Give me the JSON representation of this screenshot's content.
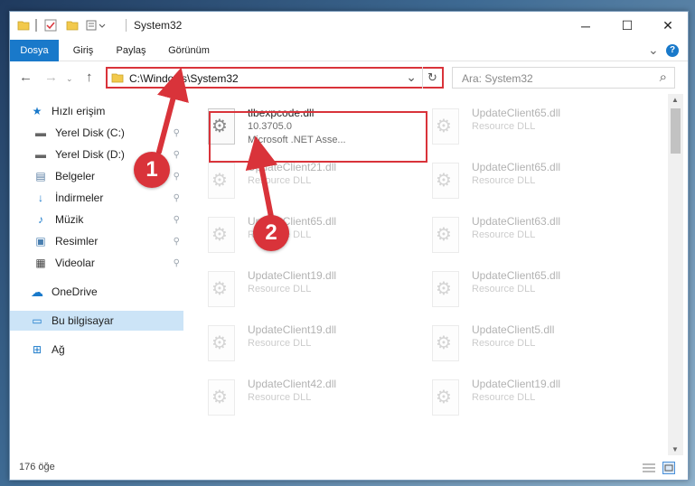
{
  "window": {
    "title": "System32",
    "min_glyph": "─",
    "max_glyph": "☐",
    "close_glyph": "✕"
  },
  "ribbon": {
    "tabs": [
      "Dosya",
      "Giriş",
      "Paylaş",
      "Görünüm"
    ],
    "expand_glyph": "⌄",
    "help_glyph": "?"
  },
  "nav": {
    "back_glyph": "←",
    "forward_glyph": "→",
    "up_glyph": "↑",
    "path": "C:\\Windows\\System32",
    "dropdown_glyph": "⌄",
    "refresh_glyph": "↻",
    "search_placeholder": "Ara: System32",
    "search_glyph": "⌕"
  },
  "sidebar": {
    "items": [
      {
        "label": "Hızlı erişim",
        "icon": "star-icon",
        "glyph": "★",
        "pinned": false
      },
      {
        "label": "Yerel Disk (C:)",
        "icon": "drive-icon",
        "glyph": "▬",
        "pinned": true
      },
      {
        "label": "Yerel Disk (D:)",
        "icon": "drive-icon",
        "glyph": "▬",
        "pinned": true
      },
      {
        "label": "Belgeler",
        "icon": "documents-icon",
        "glyph": "▤",
        "pinned": true
      },
      {
        "label": "İndirmeler",
        "icon": "download-icon",
        "glyph": "↓",
        "pinned": true
      },
      {
        "label": "Müzik",
        "icon": "music-icon",
        "glyph": "♪",
        "pinned": true
      },
      {
        "label": "Resimler",
        "icon": "pictures-icon",
        "glyph": "▣",
        "pinned": true
      },
      {
        "label": "Videolar",
        "icon": "video-icon",
        "glyph": "▦",
        "pinned": true
      },
      {
        "label": "OneDrive",
        "icon": "cloud-icon",
        "glyph": "☁",
        "pinned": false
      },
      {
        "label": "Bu bilgisayar",
        "icon": "computer-icon",
        "glyph": "▭",
        "pinned": false
      },
      {
        "label": "Ağ",
        "icon": "network-icon",
        "glyph": "⊞",
        "pinned": false
      }
    ],
    "pin_glyph": "⚲"
  },
  "files": [
    {
      "name": "tlbexpcode.dll",
      "line2": "10.3705.0",
      "line3": "Microsoft .NET Asse...",
      "highlighted": true
    },
    {
      "name": "UpdateClient65.dll",
      "line2": "Resource DLL"
    },
    {
      "name": "UpdateClient21.dll",
      "line2": "Resource DLL"
    },
    {
      "name": "UpdateClient65.dll",
      "line2": "Resource DLL"
    },
    {
      "name": "UpdateClient65.dll",
      "line2": "Resource DLL"
    },
    {
      "name": "UpdateClient63.dll",
      "line2": "Resource DLL"
    },
    {
      "name": "UpdateClient19.dll",
      "line2": "Resource DLL"
    },
    {
      "name": "UpdateClient65.dll",
      "line2": "Resource DLL"
    },
    {
      "name": "UpdateClient19.dll",
      "line2": "Resource DLL"
    },
    {
      "name": "UpdateClient5.dll",
      "line2": "Resource DLL"
    },
    {
      "name": "UpdateClient42.dll",
      "line2": "Resource DLL"
    },
    {
      "name": "UpdateClient19.dll",
      "line2": "Resource DLL"
    }
  ],
  "status": {
    "item_count": "176 öğe"
  },
  "annotations": {
    "step1": "1",
    "step2": "2",
    "color": "#d9333a"
  }
}
